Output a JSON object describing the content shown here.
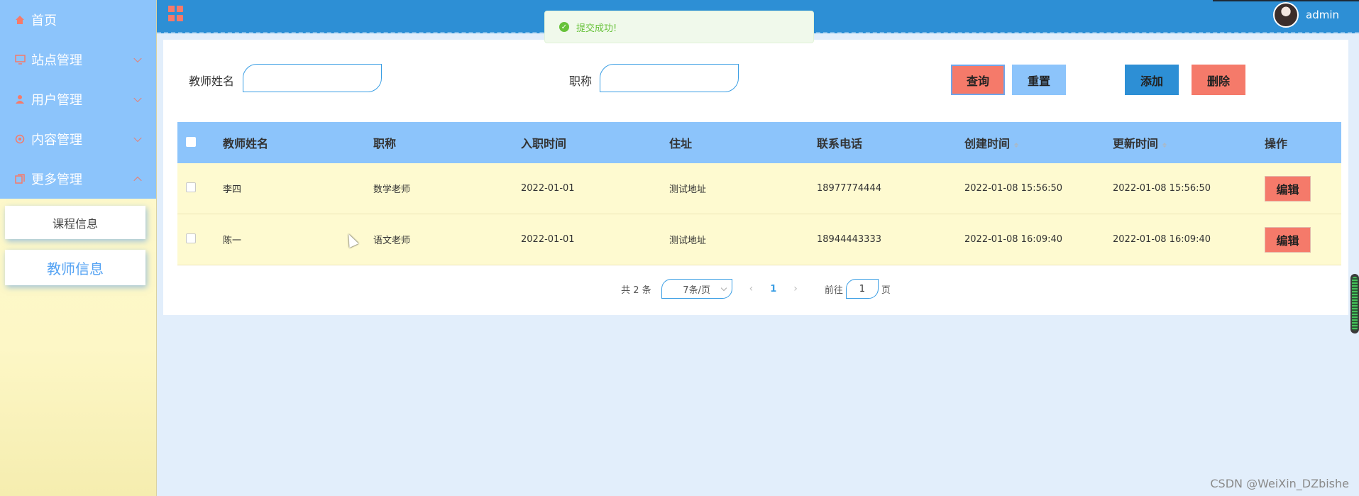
{
  "sidebar": {
    "items": [
      {
        "label": "首页",
        "icon": "home-icon"
      },
      {
        "label": "站点管理",
        "icon": "monitor-icon"
      },
      {
        "label": "用户管理",
        "icon": "user-icon"
      },
      {
        "label": "内容管理",
        "icon": "content-icon"
      },
      {
        "label": "更多管理",
        "icon": "more-icon"
      }
    ],
    "submenu": [
      "课程信息",
      "教师信息"
    ]
  },
  "header": {
    "username": "admin"
  },
  "toast": {
    "message": "提交成功!"
  },
  "filters": {
    "name_label": "教师姓名",
    "name_value": "",
    "title_label": "职称",
    "title_value": ""
  },
  "buttons": {
    "query": "查询",
    "reset": "重置",
    "add": "添加",
    "delete": "删除",
    "edit": "编辑"
  },
  "table": {
    "headers": [
      "教师姓名",
      "职称",
      "入职时间",
      "住址",
      "联系电话",
      "创建时间",
      "更新时间",
      "操作"
    ],
    "rows": [
      {
        "name": "李四",
        "title": "数学老师",
        "hire_date": "2022-01-01",
        "address": "测试地址",
        "phone": "18977774444",
        "created": "2022-01-08 15:56:50",
        "updated": "2022-01-08 15:56:50"
      },
      {
        "name": "陈一",
        "title": "语文老师",
        "hire_date": "2022-01-01",
        "address": "测试地址",
        "phone": "18944443333",
        "created": "2022-01-08 16:09:40",
        "updated": "2022-01-08 16:09:40"
      }
    ]
  },
  "pagination": {
    "total": "共 2 条",
    "page_size": "7条/页",
    "current_page": "1",
    "goto_prefix": "前往",
    "goto_value": "1",
    "goto_suffix": "页"
  },
  "watermark": "CSDN @WeiXin_DZbishe",
  "colors": {
    "header": "#2d8fd5",
    "sidebar_menu": "#8cc4fb",
    "accent_red": "#f57a6a",
    "row_bg": "#fefad0",
    "success": "#67c23a"
  }
}
